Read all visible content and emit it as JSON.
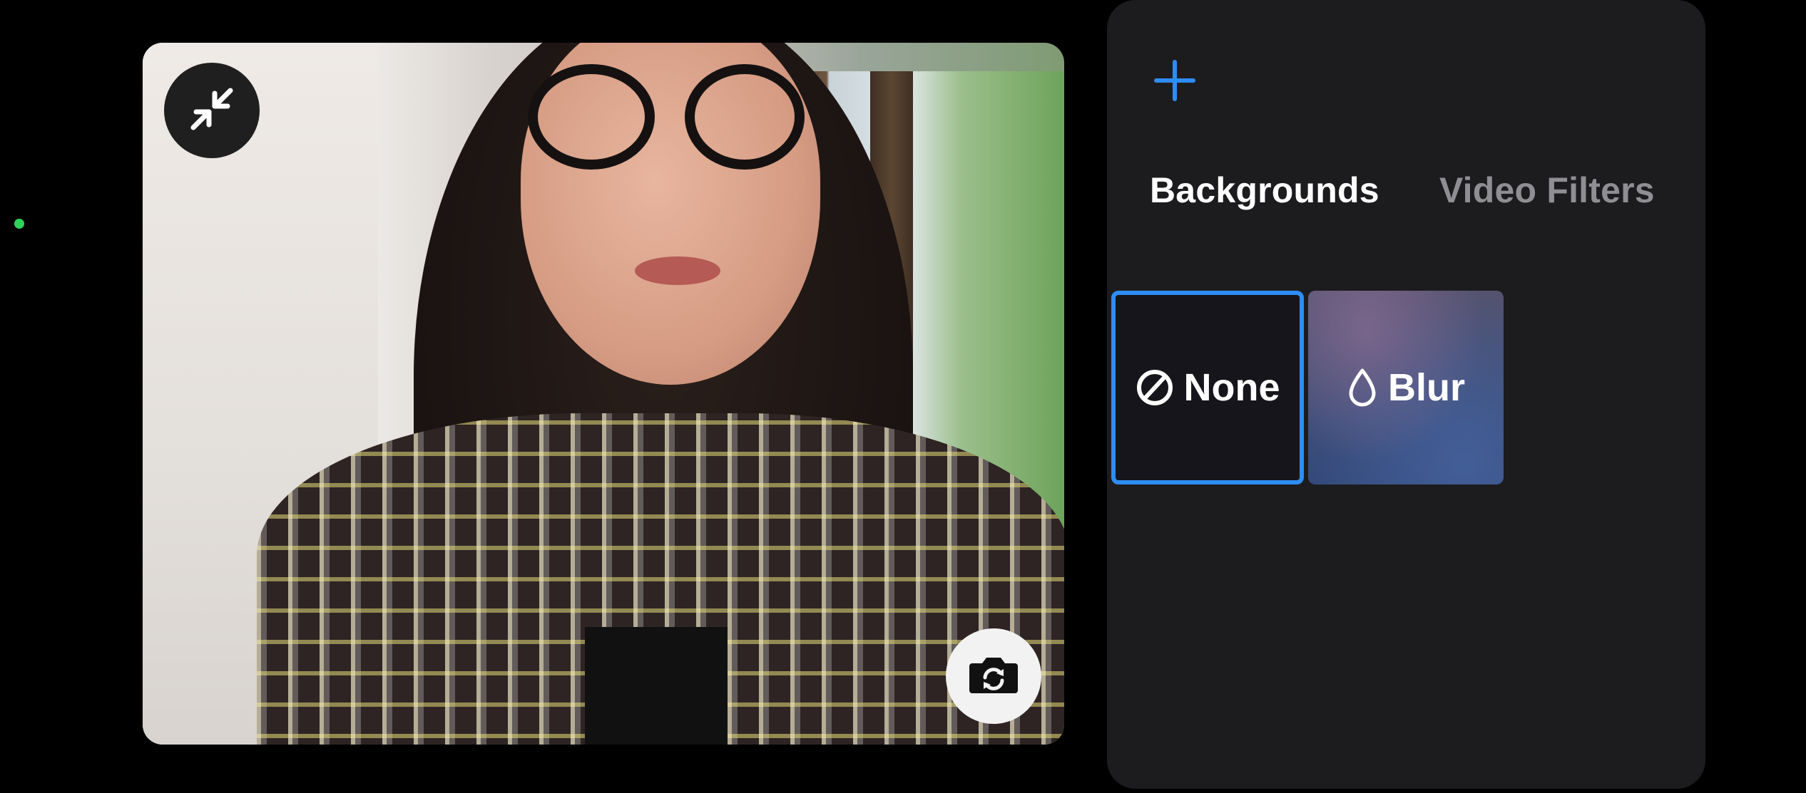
{
  "camera": {
    "collapse_icon": "collapse-arrows-icon",
    "flip_icon": "camera-flip-icon"
  },
  "panel": {
    "add_icon": "plus-icon",
    "tabs": [
      {
        "label": "Backgrounds",
        "active": true
      },
      {
        "label": "Video Filters",
        "active": false
      }
    ],
    "backgrounds": [
      {
        "label": "None",
        "icon": "prohibited-icon",
        "selected": true
      },
      {
        "label": "Blur",
        "icon": "droplet-icon",
        "selected": false
      }
    ]
  },
  "colors": {
    "accent": "#2f8cf5",
    "panel_bg": "#1c1c1e",
    "status_dot": "#30d158"
  }
}
